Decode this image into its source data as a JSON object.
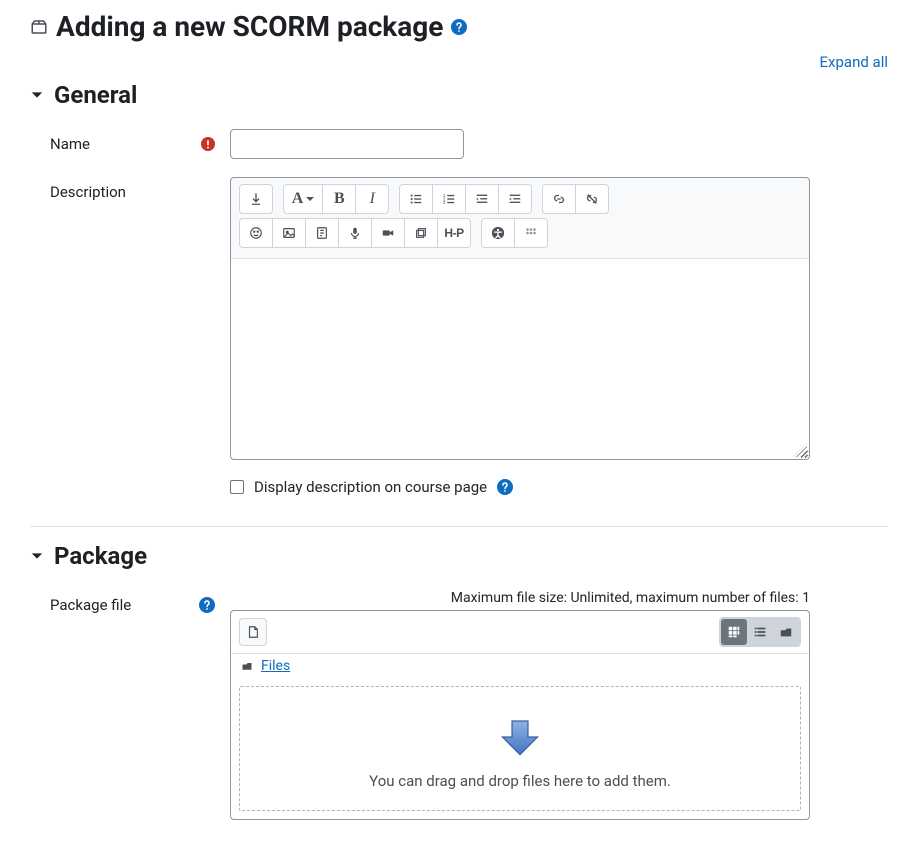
{
  "page": {
    "title": "Adding a new SCORM package",
    "expand_all": "Expand all"
  },
  "general": {
    "heading": "General",
    "name_label": "Name",
    "name_value": "",
    "description_label": "Description",
    "display_desc_label": "Display description on course page"
  },
  "editor": {
    "h5p_label": "H-P"
  },
  "package": {
    "heading": "Package",
    "file_label": "Package file",
    "limits": "Maximum file size: Unlimited, maximum number of files: 1",
    "files_link": "Files",
    "dropzone_text": "You can drag and drop files here to add them."
  }
}
